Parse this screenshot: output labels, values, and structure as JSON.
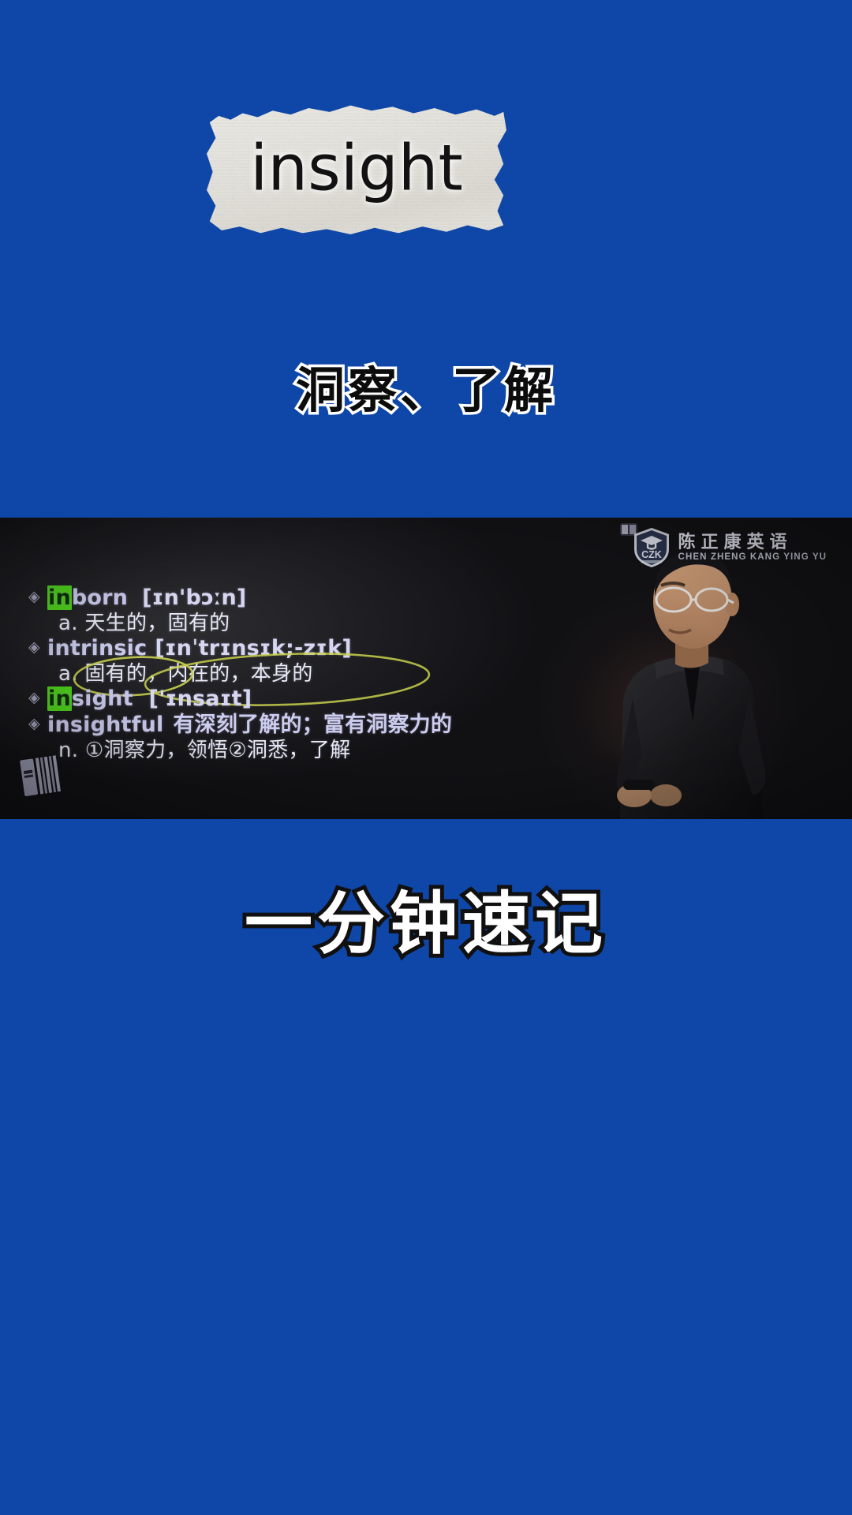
{
  "banner": {
    "headword": "insight",
    "gloss": "洞察、了解"
  },
  "video": {
    "watermark": {
      "logo_text": "CZK",
      "brand_cn": "陈正康英语",
      "brand_en": "CHEN ZHENG KANG YING YU",
      "shield_icon": "graduation-cap-shield-icon",
      "mini_icon": "open-book-icon"
    },
    "book_icon": "book-stack-icon",
    "vocabulary": [
      {
        "bullet": "◈",
        "prefix_highlight": "in",
        "term_rest": "born",
        "ipa": "[ɪn'bɔːn]",
        "definition": "a. 天生的，固有的",
        "definition_bold": false
      },
      {
        "bullet": "◈",
        "prefix_highlight": "",
        "term_rest": "intrinsic",
        "ipa": "[ɪnˈtrɪnsɪk;-zɪk]",
        "definition": "a. 固有的，内在的，本身的",
        "definition_bold": false
      },
      {
        "bullet": "◈",
        "prefix_highlight": "in",
        "term_rest": "sight",
        "ipa": "['ɪnsaɪt]",
        "definition": "",
        "definition_bold": false
      },
      {
        "bullet": "◈",
        "prefix_highlight": "",
        "term_rest": "insightful",
        "ipa": "有深刻了解的；富有洞察力的",
        "definition": "n. ①洞察力，领悟②洞悉，了解",
        "definition_bold": false
      }
    ]
  },
  "cta": {
    "text": "一分钟速记"
  },
  "colors": {
    "background_blue": "#0f47a8",
    "paper": "#e4e2dc",
    "highlight_green": "#4fd21c",
    "term_lavender": "#ccccee",
    "annotation_yellow": "#c8cf4a"
  }
}
